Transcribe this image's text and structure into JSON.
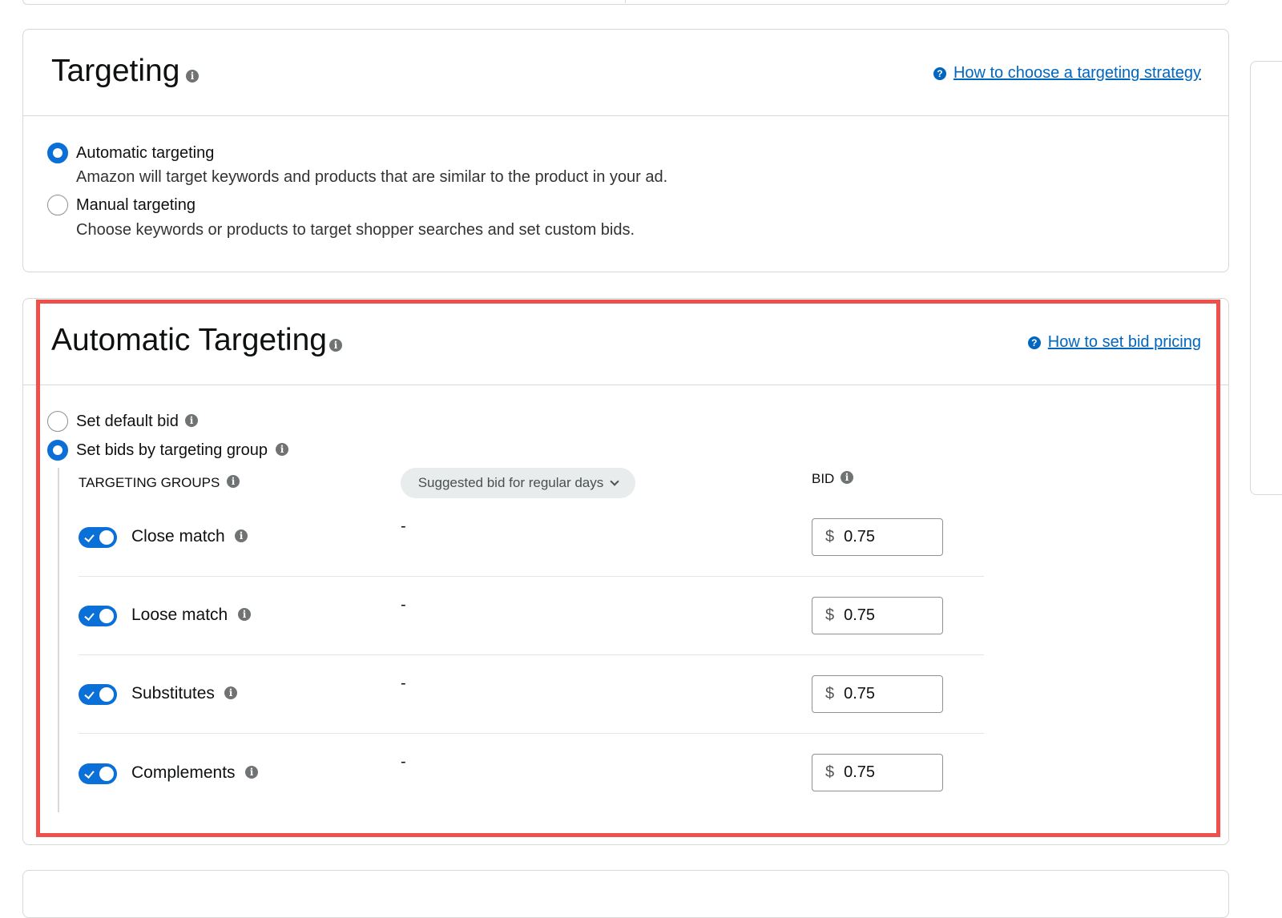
{
  "colors": {
    "accent": "#0a6fd6",
    "link": "#0066c0",
    "highlight_border": "#f0504b",
    "card_border": "#d5d9d9"
  },
  "targeting": {
    "title": "Targeting",
    "help_link": "How to choose a targeting strategy",
    "options": [
      {
        "label": "Automatic targeting",
        "description": "Amazon will target keywords and products that are similar to the product in your ad.",
        "selected": true
      },
      {
        "label": "Manual targeting",
        "description": "Choose keywords or products to target shopper searches and set custom bids.",
        "selected": false
      }
    ]
  },
  "automatic": {
    "title": "Automatic Targeting",
    "help_link": "How to set bid pricing",
    "bid_options": [
      {
        "label": "Set default bid",
        "selected": false
      },
      {
        "label": "Set bids by targeting group",
        "selected": true
      }
    ],
    "columns": {
      "groups": "TARGETING GROUPS",
      "suggested": "Suggested bid for regular days",
      "bid": "BID"
    },
    "rows": [
      {
        "label": "Close match",
        "enabled": true,
        "suggested": "-",
        "currency": "$",
        "bid": "0.75"
      },
      {
        "label": "Loose match",
        "enabled": true,
        "suggested": "-",
        "currency": "$",
        "bid": "0.75"
      },
      {
        "label": "Substitutes",
        "enabled": true,
        "suggested": "-",
        "currency": "$",
        "bid": "0.75"
      },
      {
        "label": "Complements",
        "enabled": true,
        "suggested": "-",
        "currency": "$",
        "bid": "0.75"
      }
    ]
  }
}
